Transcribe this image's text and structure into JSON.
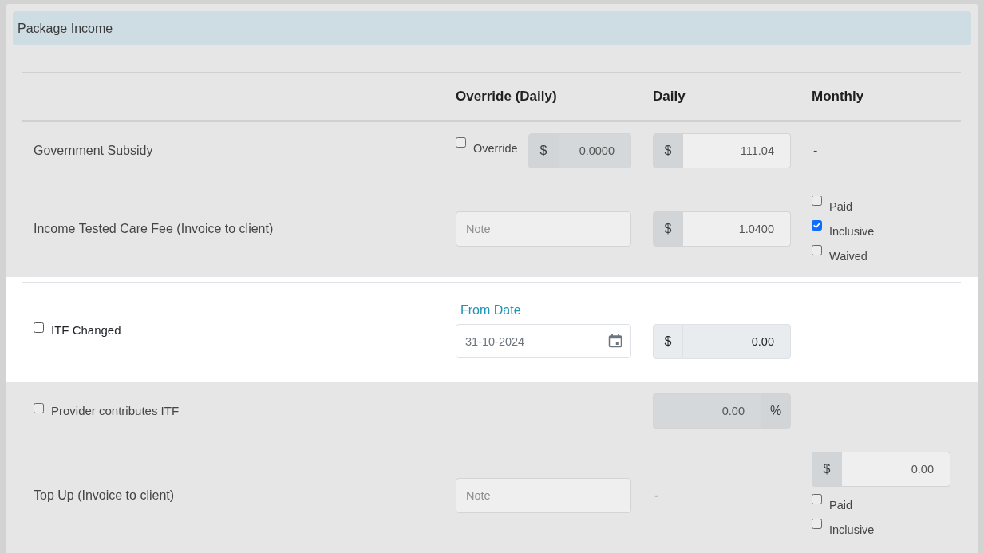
{
  "section": {
    "title": "Package Income"
  },
  "table": {
    "columns": [
      {
        "label": "Override (Daily)"
      },
      {
        "label": "Daily"
      },
      {
        "label": "Monthly"
      }
    ],
    "rows": [
      {
        "highlighted": false,
        "label": {
          "kind": "text",
          "text": "Government Subsidy"
        },
        "override": {
          "kind": "override",
          "checkbox": {
            "label": "Override",
            "checked": false
          },
          "prefix": "$",
          "value": "0.0000",
          "disabled": true
        },
        "daily": {
          "kind": "amount",
          "prefix": "$",
          "value": "111.04",
          "disabled": false
        },
        "monthly": {
          "kind": "text",
          "text": "-"
        }
      },
      {
        "highlighted": false,
        "label": {
          "kind": "text",
          "text": "Income Tested Care Fee (Invoice to client)"
        },
        "override": {
          "kind": "note",
          "placeholder": "Note"
        },
        "daily": {
          "kind": "amount",
          "prefix": "$",
          "value": "1.0400",
          "disabled": false
        },
        "monthly": {
          "kind": "checks",
          "items": [
            {
              "label": "Paid",
              "checked": false
            },
            {
              "label": "Inclusive",
              "checked": true
            },
            {
              "label": "Waived",
              "checked": false
            }
          ]
        }
      },
      {
        "highlighted": true,
        "label": {
          "kind": "checkbox",
          "text": "ITF Changed",
          "checked": false
        },
        "override": {
          "kind": "date",
          "label": "From Date",
          "placeholder": "31-10-2024"
        },
        "daily": {
          "kind": "amount",
          "prefix": "$",
          "value": "0.00",
          "disabled": true
        }
      },
      {
        "highlighted": false,
        "label": {
          "kind": "checkbox",
          "text": "Provider contributes ITF",
          "checked": false
        },
        "daily": {
          "kind": "amount",
          "suffix": "%",
          "value": "0.00",
          "disabled": true
        }
      },
      {
        "highlighted": false,
        "label": {
          "kind": "text",
          "text": "Top Up (Invoice to client)"
        },
        "override": {
          "kind": "note",
          "placeholder": "Note"
        },
        "daily": {
          "kind": "text",
          "text": "-"
        },
        "monthly": {
          "kind": "amount-checks",
          "prefix": "$",
          "value": "0.00",
          "disabled": false,
          "items": [
            {
              "label": "Paid",
              "checked": false
            },
            {
              "label": "Inclusive",
              "checked": false
            }
          ]
        }
      }
    ]
  }
}
